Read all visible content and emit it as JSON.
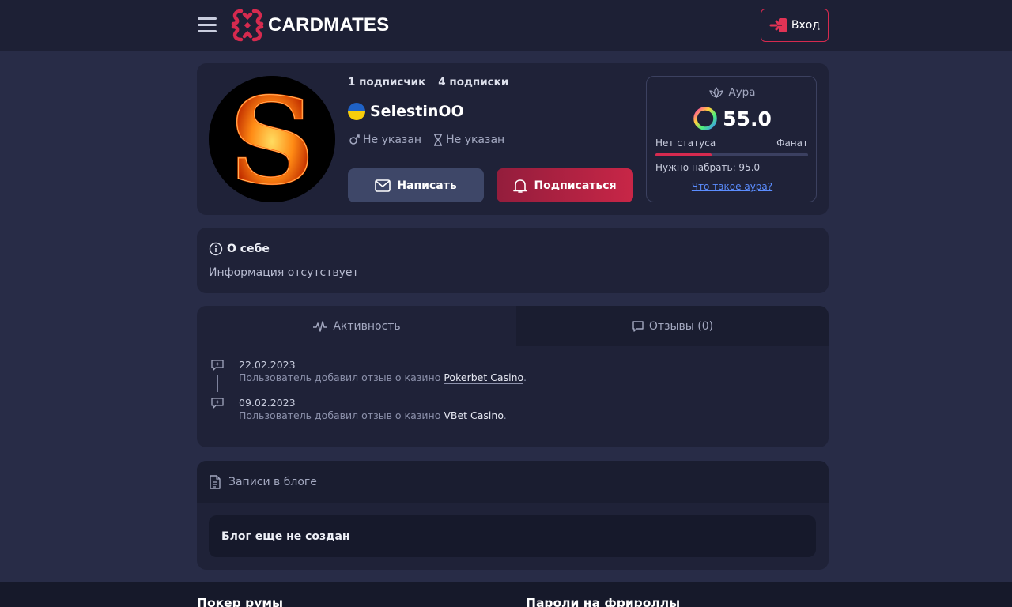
{
  "header": {
    "brand": "CARDMATES",
    "login_label": "Вход",
    "colors": {
      "accent": "#d62a4f",
      "bg": "#1d2035"
    }
  },
  "profile": {
    "followers": "1 подписчик",
    "following": "4 подписки",
    "username": "SelestinOO",
    "country_flag": "ukraine-flag",
    "gender": "Не указан",
    "age": "Не указан",
    "write_label": "Написать",
    "subscribe_label": "Подписаться"
  },
  "aura": {
    "title": "Аура",
    "value": "55.0",
    "status_current": "Нет статуса",
    "status_next": "Фанат",
    "progress": 0.37,
    "need_text": "Нужно набрать: 95.0",
    "link": "Что такое аура?"
  },
  "about": {
    "title": "О себе",
    "text": "Информация отсутствует"
  },
  "activity": {
    "tab_activity": "Активность",
    "tab_reviews": "Отзывы (0)",
    "events": [
      {
        "date": "22.02.2023",
        "text": "Пользователь добавил отзыв о казино",
        "casino": "Pokerbet Casino"
      },
      {
        "date": "09.02.2023",
        "text": "Пользователь добавил отзыв о казино",
        "casino": "VBet Casino"
      }
    ]
  },
  "blog": {
    "title": "Записи в блоге",
    "empty": "Блог еще не создан"
  },
  "footer": {
    "col1": "Покер румы",
    "col2": "Пароли на фрироллы"
  }
}
